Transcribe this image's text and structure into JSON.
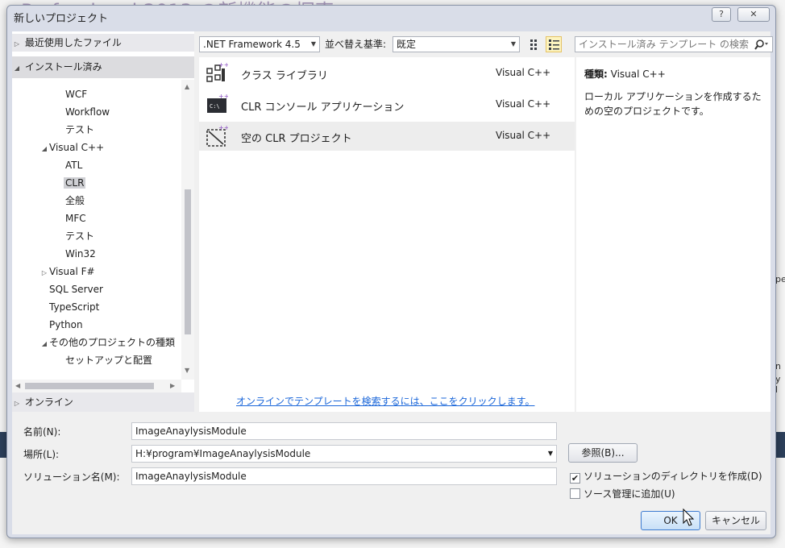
{
  "background": {
    "title_fragment": "Professional 2013 の新機能の探索",
    "right_fragments": [
      "pe",
      "n",
      "y l"
    ]
  },
  "dialog": {
    "title": "新しいプロジェクト",
    "help_label": "?",
    "close_label": "✕"
  },
  "sidebar": {
    "recent": "最近使用したファイル",
    "installed": "インストール済み",
    "online": "オンライン",
    "tree": [
      {
        "label": "WCF",
        "level": 2
      },
      {
        "label": "Workflow",
        "level": 2
      },
      {
        "label": "テスト",
        "level": 2
      },
      {
        "label": "Visual C++",
        "level": 1,
        "expanded": true
      },
      {
        "label": "ATL",
        "level": 2
      },
      {
        "label": "CLR",
        "level": 2,
        "selected": true
      },
      {
        "label": "全般",
        "level": 2
      },
      {
        "label": "MFC",
        "level": 2
      },
      {
        "label": "テスト",
        "level": 2
      },
      {
        "label": "Win32",
        "level": 2
      },
      {
        "label": "Visual F#",
        "level": 1,
        "collapsed": true
      },
      {
        "label": "SQL Server",
        "level": 1
      },
      {
        "label": "TypeScript",
        "level": 1
      },
      {
        "label": "Python",
        "level": 1
      },
      {
        "label": "その他のプロジェクトの種類",
        "level": 1,
        "expanded": true
      },
      {
        "label": "セットアップと配置",
        "level": 2
      }
    ]
  },
  "toolbar": {
    "framework": ".NET Framework 4.5",
    "sort_label": "並べ替え基準:",
    "sort_value": "既定",
    "search_placeholder": "インストール済み テンプレート の検索"
  },
  "templates": [
    {
      "name": "クラス ライブラリ",
      "lang": "Visual C++",
      "icon": "class-library-icon"
    },
    {
      "name": "CLR コンソール アプリケーション",
      "lang": "Visual C++",
      "icon": "console-app-icon"
    },
    {
      "name": "空の CLR プロジェクト",
      "lang": "Visual C++",
      "icon": "empty-project-icon",
      "selected": true
    }
  ],
  "online_link": "オンラインでテンプレートを検索するには、ここをクリックします。",
  "details": {
    "kind_label": "種類:",
    "kind_value": "Visual C++",
    "description": "ローカル アプリケーションを作成するための空のプロジェクトです。"
  },
  "form": {
    "name_label": "名前(N):",
    "name_value": "ImageAnaylysisModule",
    "location_label": "場所(L):",
    "location_value": "H:¥program¥ImageAnaylysisModule",
    "browse_label": "参照(B)...",
    "solution_label": "ソリューション名(M):",
    "solution_value": "ImageAnaylysisModule",
    "create_dir_label": "ソリューションのディレクトリを作成(D)",
    "create_dir_checked": true,
    "source_control_label": "ソース管理に追加(U)",
    "source_control_checked": false,
    "ok_label": "OK",
    "cancel_label": "キャンセル"
  }
}
